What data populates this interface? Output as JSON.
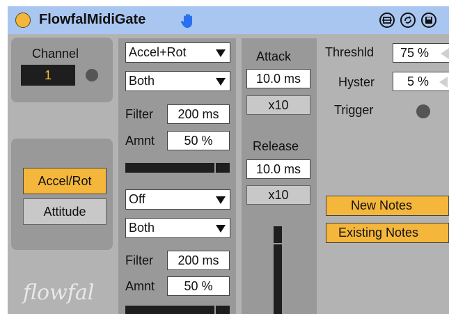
{
  "title": "FlowfalMidiGate",
  "titlebar_icons": [
    "hand-icon",
    "freeze-icon",
    "refresh-icon",
    "save-icon"
  ],
  "colors": {
    "accent": "#f5b73b",
    "titlebar": "#a9c6f1",
    "panel": "#999999",
    "background": "#b3b3b3"
  },
  "channel": {
    "label": "Channel",
    "value": "1"
  },
  "mode": {
    "accel_rot": "Accel/Rot",
    "attitude": "Attitude",
    "selected": "Accel/Rot"
  },
  "logo_text": "flowfal",
  "source1": {
    "dropdown": "Accel+Rot",
    "axis": "Both",
    "filter_label": "Filter",
    "filter_value": "200 ms",
    "amount_label": "Amnt",
    "amount_value": "50 %",
    "meter_level": 0.92
  },
  "source2": {
    "dropdown": "Off",
    "axis": "Both",
    "filter_label": "Filter",
    "filter_value": "200 ms",
    "amount_label": "Amnt",
    "amount_value": "50 %",
    "meter_level": 0.92
  },
  "envelope": {
    "attack_label": "Attack",
    "attack_value": "10.0 ms",
    "attack_mult": "x10",
    "release_label": "Release",
    "release_value": "10.0 ms",
    "release_mult": "x10"
  },
  "gate": {
    "threshold_label": "Threshld",
    "threshold_value": "75 %",
    "hyster_label": "Hyster",
    "hyster_value": "5 %",
    "trigger_label": "Trigger",
    "new_notes": "New Notes",
    "existing_notes": "Existing Notes"
  }
}
